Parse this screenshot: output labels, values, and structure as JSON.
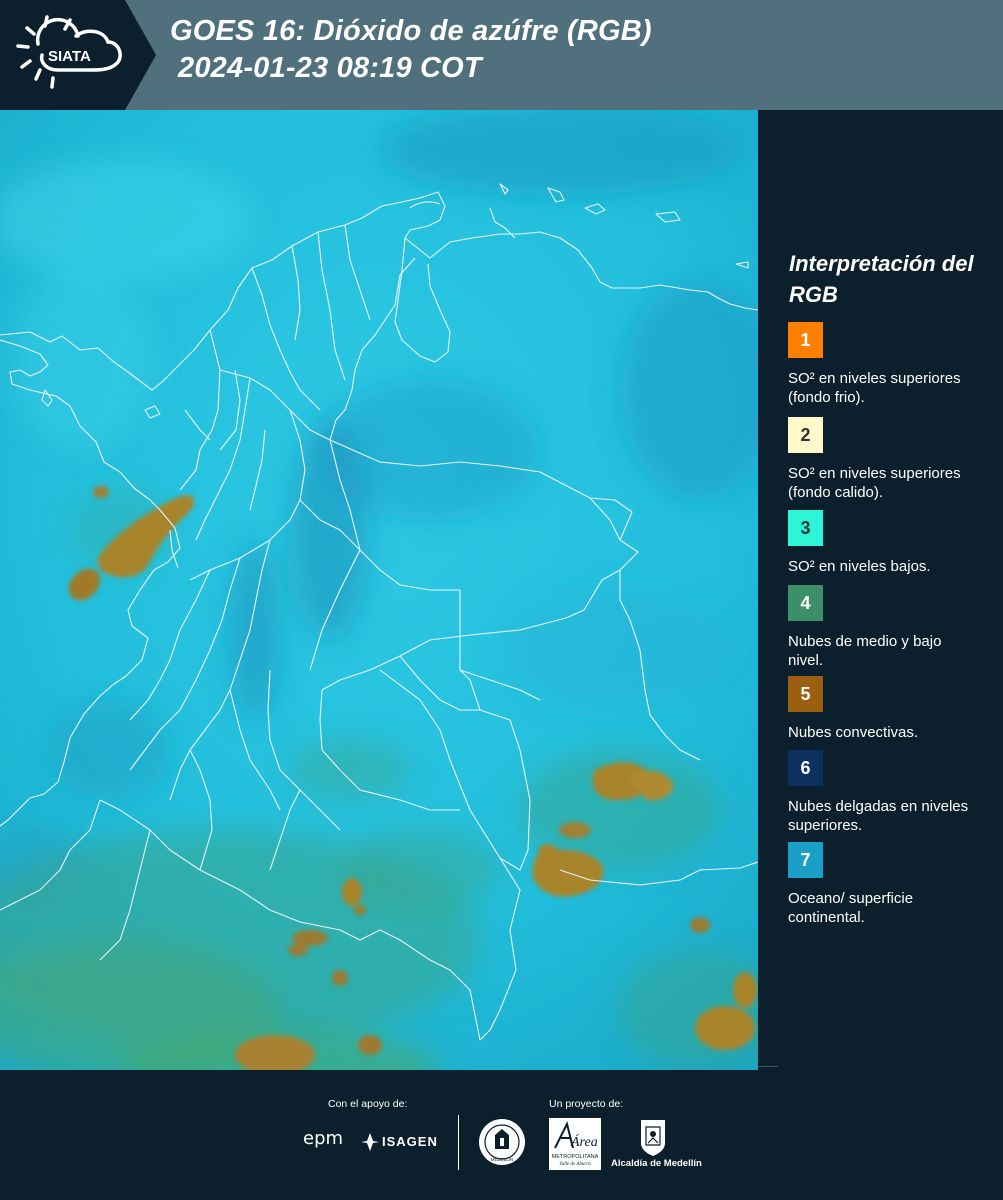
{
  "header": {
    "logo_text": "SIATA",
    "title_line1": "GOES 16: Dióxido de azúfre (RGB)",
    "title_line2": "2024-01-23 08:19 COT",
    "bg_color": "#50707d"
  },
  "legend": {
    "title": "Interpretación del RGB",
    "items": [
      {
        "number": "1",
        "color": "#ff7f00",
        "number_color": "#ffffff",
        "text": "SO² en niveles superiores (fondo frio)."
      },
      {
        "number": "2",
        "color": "#fff8c8",
        "number_color": "#333333",
        "text": "SO² en niveles superiores (fondo calido)."
      },
      {
        "number": "3",
        "color": "#2ef5d8",
        "number_color": "#1a3a3a",
        "text": "SO² en niveles bajos."
      },
      {
        "number": "4",
        "color": "#3c9068",
        "number_color": "#ffffff",
        "text": "Nubes de medio y bajo nivel."
      },
      {
        "number": "5",
        "color": "#9a6010",
        "number_color": "#ffffff",
        "text": "Nubes convectivas."
      },
      {
        "number": "6",
        "color": "#0e3060",
        "number_color": "#ffffff",
        "text": "Nubes delgadas en niveles superiores."
      },
      {
        "number": "7",
        "color": "#1aa0c8",
        "number_color": "#ffffff",
        "text": "Oceano/ superficie continental."
      }
    ]
  },
  "footer": {
    "support_label": "Con el apoyo de:",
    "project_label": "Un proyecto de:",
    "sponsors": [
      "epm",
      "ISAGEN"
    ],
    "partners": [
      "Área Metropolitana Valle de Aburrá",
      "Alcaldía de Medellín"
    ],
    "alcaldia_label": "Alcaldía de Medellín",
    "area_logo_text": "Área",
    "area_logo_sub": "METROPOLITANA",
    "area_logo_sub2": "Valle de Aburrá",
    "seal_text": "MEDELLÍN"
  },
  "map": {
    "background_color": "#27c4e0",
    "border_color": "#e8f4f8",
    "convective_color": "#a8842a"
  }
}
